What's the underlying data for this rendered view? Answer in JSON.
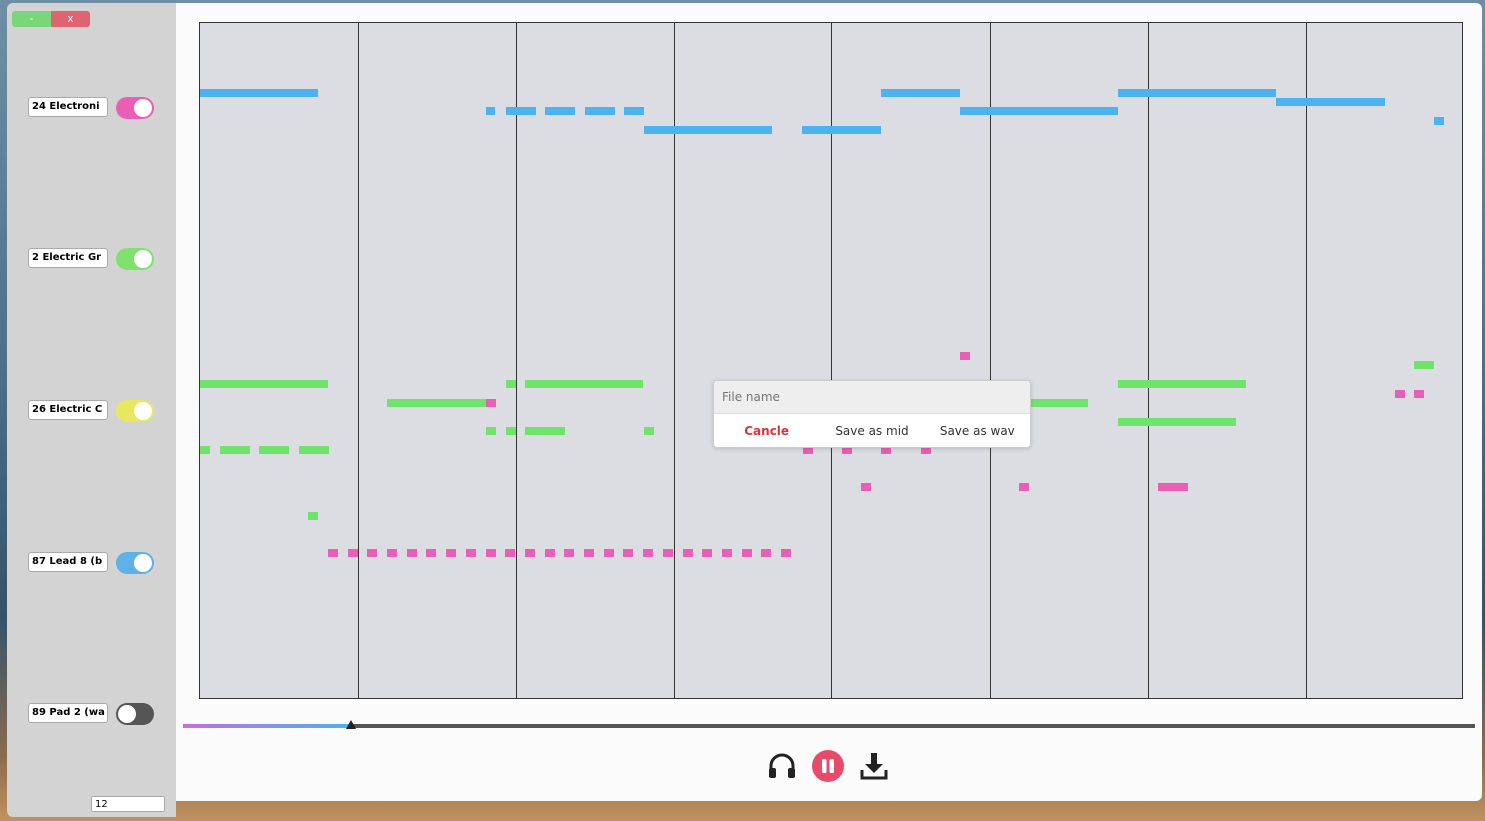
{
  "window": {
    "min_label": "-",
    "close_label": "x"
  },
  "tracks": [
    {
      "name": "24 Electroni",
      "color": "#e85fb5",
      "enabled": true
    },
    {
      "name": "2 Electric Gr",
      "color": "#7fe26f",
      "enabled": true
    },
    {
      "name": "26 Electric C",
      "color": "#e8e85f",
      "enabled": true
    },
    {
      "name": "87 Lead 8 (b",
      "color": "#5fb2e8",
      "enabled": true
    },
    {
      "name": "89 Pad 2 (wa",
      "color": "#555555",
      "enabled": false
    }
  ],
  "bpm_value": "12",
  "playback_progress_percent": 13,
  "controls": {
    "headphones_icon": "headphones-icon",
    "pause_icon": "pause-icon",
    "download_icon": "download-icon"
  },
  "dialog": {
    "placeholder": "File name",
    "cancel_label": "Cancle",
    "save_mid_label": "Save as mid",
    "save_wav_label": "Save as wav"
  },
  "colors": {
    "blue_notes": "#4db3f0",
    "green_notes": "#6fe36a",
    "pink_notes": "#e85fb5",
    "accent": "#e84a6a"
  }
}
